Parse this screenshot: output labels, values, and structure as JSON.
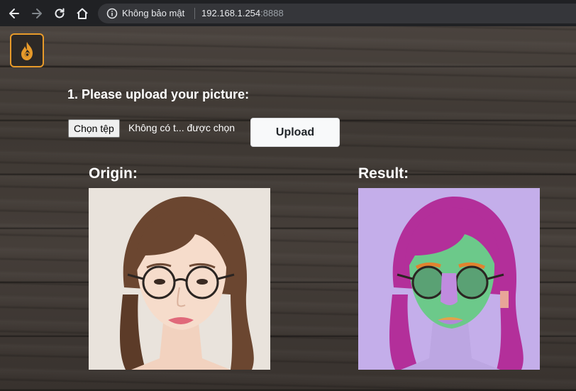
{
  "browser": {
    "security_label": "Không bảo mật",
    "host": "192.168.1.254",
    "port": ":8888"
  },
  "header": {
    "logo_icon": "flame-logo-icon",
    "accent_color": "#e79a2a"
  },
  "upload": {
    "heading": "1. Please upload your picture:",
    "choose_file_label": "Chọn tệp",
    "file_status": "Không có t... được chọn",
    "upload_button": "Upload"
  },
  "images": {
    "origin_label": "Origin:",
    "result_label": "Result:"
  }
}
